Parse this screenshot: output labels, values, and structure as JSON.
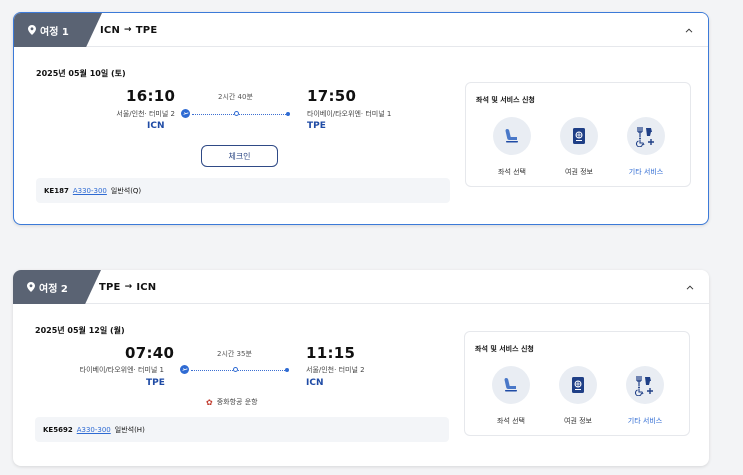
{
  "colors": {
    "accent": "#2f6bd3",
    "tag_bg": "#5a6373",
    "active_border": "#3c7ad8",
    "navy": "#1f4ba5"
  },
  "journeys": [
    {
      "label": "여정 1",
      "route_from": "ICN",
      "route_to": "TPE",
      "date": "2025년 05월 10일 (토)",
      "dep_time": "16:10",
      "dep_terminal": "서울/인천· 터미널 2",
      "dep_code": "ICN",
      "duration": "2시간 40분",
      "arr_time": "17:50",
      "arr_terminal": "타이베이/타오위엔· 터미널 1",
      "arr_code": "TPE",
      "checkin_label": "체크인",
      "flight_no": "KE187",
      "aircraft": "A330-300",
      "cabin": "일반석(Q)",
      "services_title": "좌석 및 서비스 신청",
      "services": [
        {
          "label": "좌석 선택",
          "icon": "seat-icon"
        },
        {
          "label": "여권 정보",
          "icon": "passport-icon"
        },
        {
          "label": "기타 서비스",
          "icon": "other-services-icon"
        }
      ]
    },
    {
      "label": "여정 2",
      "route_from": "TPE",
      "route_to": "ICN",
      "date": "2025년 05월 12일 (월)",
      "dep_time": "07:40",
      "dep_terminal": "타이베이/타오위엔· 터미널 1",
      "dep_code": "TPE",
      "duration": "2시간 35분",
      "arr_time": "11:15",
      "arr_terminal": "서울/인천· 터미널 2",
      "arr_code": "ICN",
      "operated_by": "중화항공 운항",
      "flight_no": "KE5692",
      "aircraft": "A330-300",
      "cabin": "일반석(H)",
      "services_title": "좌석 및 서비스 신청",
      "services": [
        {
          "label": "좌석 선택",
          "icon": "seat-icon"
        },
        {
          "label": "여권 정보",
          "icon": "passport-icon"
        },
        {
          "label": "기타 서비스",
          "icon": "other-services-icon"
        }
      ]
    }
  ]
}
